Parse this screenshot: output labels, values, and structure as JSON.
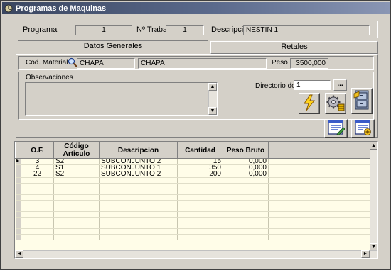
{
  "window": {
    "title": "Programas de Maquinas"
  },
  "header": {
    "programa_label": "Programa",
    "programa_value": "1",
    "trabajo_label": "Nº Trabajo",
    "trabajo_value": "1",
    "descripcion_label": "Descripción",
    "descripcion_value": "NESTIN 1"
  },
  "tabs": [
    {
      "label": "Datos Generales",
      "active": true
    },
    {
      "label": "Retales",
      "active": false
    }
  ],
  "general": {
    "cod_material_label": "Cod. Material",
    "cod_material_value": "CHAPA",
    "material_desc_value": "CHAPA",
    "peso_label": "Peso",
    "peso_value": "3500,000",
    "observaciones_label": "Observaciones",
    "directorio_label": "Directorio doc.",
    "directorio_value": "1",
    "browse_label": "..."
  },
  "icons": {
    "run": "lightning-icon",
    "settings": "gears-icon",
    "archive": "cabinet-icon",
    "edit": "list-edit-icon",
    "add": "list-add-icon"
  },
  "table": {
    "columns": [
      "O.F.",
      "Código Articulo",
      "Descripcion",
      "Cantidad",
      "Peso Bruto"
    ],
    "rows": [
      {
        "of": "3",
        "codigo": "S2",
        "descripcion": "SUBCONJUNTO 2",
        "cantidad": "15",
        "peso": "0,000",
        "current": true
      },
      {
        "of": "4",
        "codigo": "S1",
        "descripcion": "SUBCONJUNTO 1",
        "cantidad": "350",
        "peso": "0,000",
        "current": false
      },
      {
        "of": "22",
        "codigo": "S2",
        "descripcion": "SUBCONJUNTO 2",
        "cantidad": "200",
        "peso": "0,000",
        "current": false
      }
    ]
  },
  "colors": {
    "title_start": "#3a4660",
    "grid_background": "#fffde8",
    "face": "#d4d0c8"
  }
}
